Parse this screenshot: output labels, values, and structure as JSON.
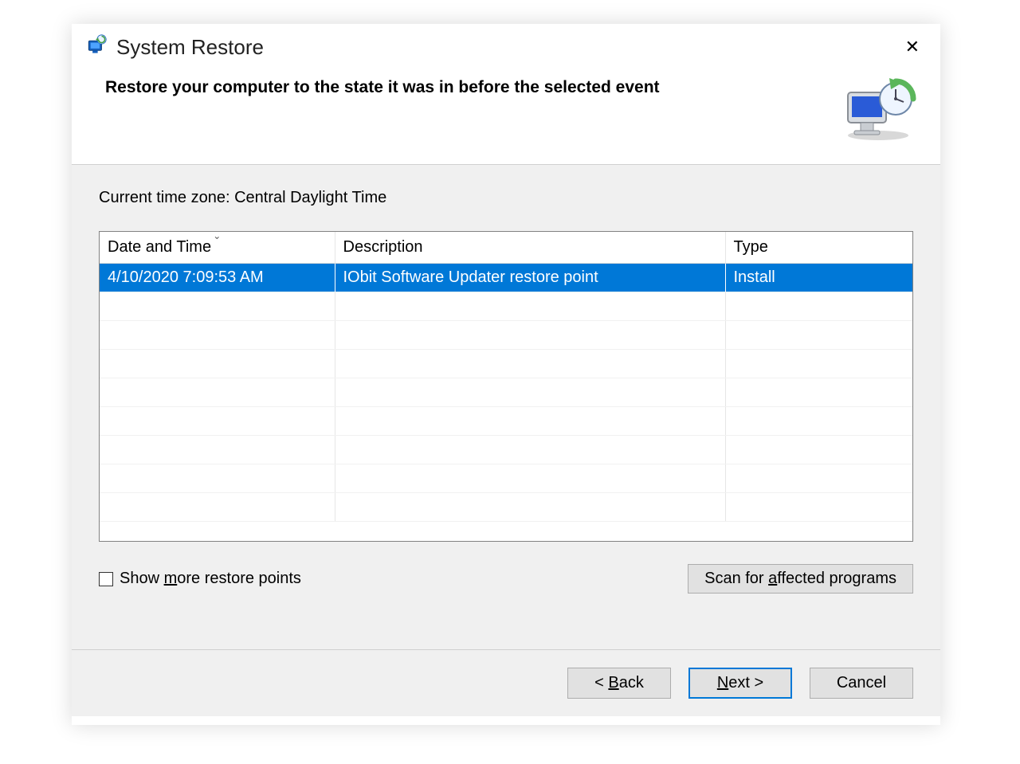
{
  "titlebar": {
    "app_name": "System Restore"
  },
  "header": {
    "heading": "Restore your computer to the state it was in before the selected event"
  },
  "content": {
    "timezone_label": "Current time zone: Central Daylight Time",
    "columns": {
      "date": "Date and Time",
      "desc": "Description",
      "type": "Type"
    },
    "rows": [
      {
        "date": "4/10/2020 7:09:53 AM",
        "desc": "IObit Software Updater restore point",
        "type": "Install",
        "selected": true
      }
    ],
    "show_more_label_pre": "Show ",
    "show_more_mnemonic": "m",
    "show_more_label_post": "ore restore points",
    "scan_label_pre": "Scan for ",
    "scan_mnemonic": "a",
    "scan_label_post": "ffected programs"
  },
  "footer": {
    "back_pre": "< ",
    "back_mnemonic": "B",
    "back_post": "ack",
    "next_mnemonic": "N",
    "next_post": "ext >",
    "cancel": "Cancel"
  }
}
